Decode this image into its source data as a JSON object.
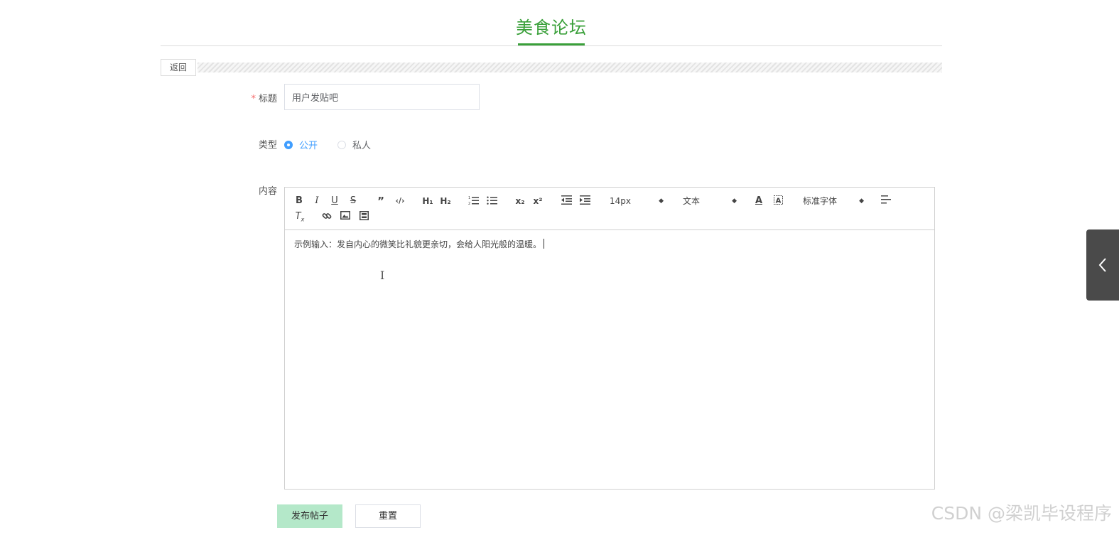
{
  "header": {
    "title": "美食论坛"
  },
  "back_button": {
    "label": "返回"
  },
  "form": {
    "title_field": {
      "label": "标题",
      "value": "用户发贴吧"
    },
    "type_field": {
      "label": "类型",
      "options": [
        {
          "label": "公开",
          "checked": true
        },
        {
          "label": "私人",
          "checked": false
        }
      ]
    },
    "content_field": {
      "label": "内容"
    }
  },
  "editor": {
    "toolbar": {
      "font_size": "14px",
      "header_select": "文本",
      "font_family": "标准字体"
    },
    "content": "示例输入：发自内心的微笑比礼貌更亲切，会给人阳光般的温暖。"
  },
  "actions": {
    "publish_label": "发布帖子",
    "reset_label": "重置"
  },
  "watermark": "CSDN @梁凯毕设程序",
  "colors": {
    "accent": "#3aa03a",
    "radio": "#409eff",
    "publish_bg": "#b4e8c9",
    "side_tab": "#4a4a4a"
  }
}
